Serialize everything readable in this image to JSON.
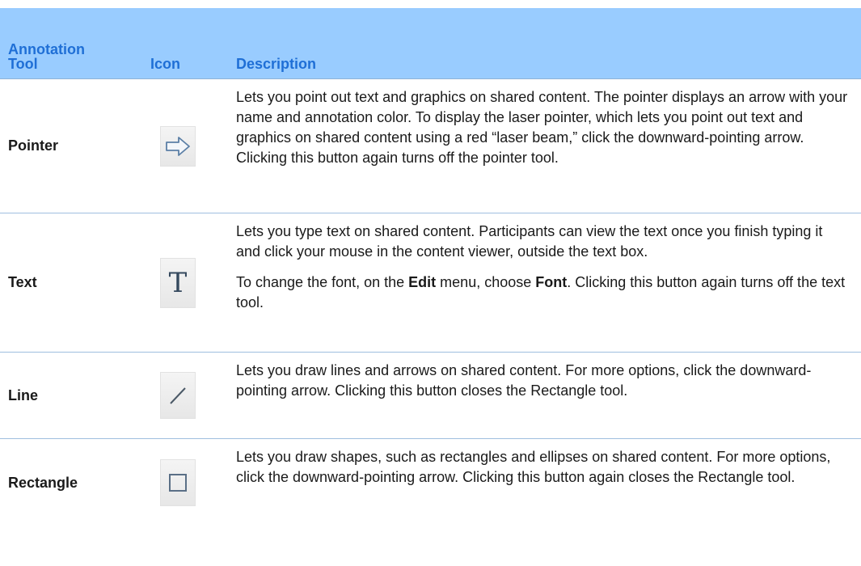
{
  "header": {
    "tool_label": "Annotation\nTool",
    "icon_label": "Icon",
    "description_label": "Description"
  },
  "rows": [
    {
      "tool": "Pointer",
      "icon": "right-arrow-icon",
      "paragraphs": [
        "Lets you point out text and graphics on shared content. The pointer displays an arrow with your name and annotation color. To display the laser pointer, which lets you point out text and graphics on shared content using a red “laser beam,” click the downward-pointing arrow. Clicking this button again turns off the pointer tool."
      ]
    },
    {
      "tool": "Text",
      "icon": "text-t-icon",
      "icon_glyph": "T",
      "paragraphs": [
        "Lets you type text on shared content. Participants can view the text once you finish typing it and click your mouse in the content viewer, outside the text box."
      ],
      "rich_paragraph": {
        "p1": "To change the font, on the ",
        "b1": "Edit",
        "p2": " menu, choose ",
        "b2": "Font",
        "p3": ". Clicking this button again turns off the text tool."
      }
    },
    {
      "tool": "Line",
      "icon": "line-icon",
      "paragraphs": [
        "Lets you draw lines and arrows on shared content. For more options, click the downward-pointing arrow. Clicking this button closes the Rectangle tool."
      ]
    },
    {
      "tool": "Rectangle",
      "icon": "rectangle-icon",
      "paragraphs": [
        "Lets you draw shapes, such as rectangles and ellipses on shared content. For more options, click the downward-pointing arrow. Clicking this button again closes the Rectangle tool."
      ]
    }
  ],
  "colors": {
    "header_bg": "#99ccff",
    "header_text": "#1f6fd6",
    "row_divider": "#9fbedf"
  }
}
